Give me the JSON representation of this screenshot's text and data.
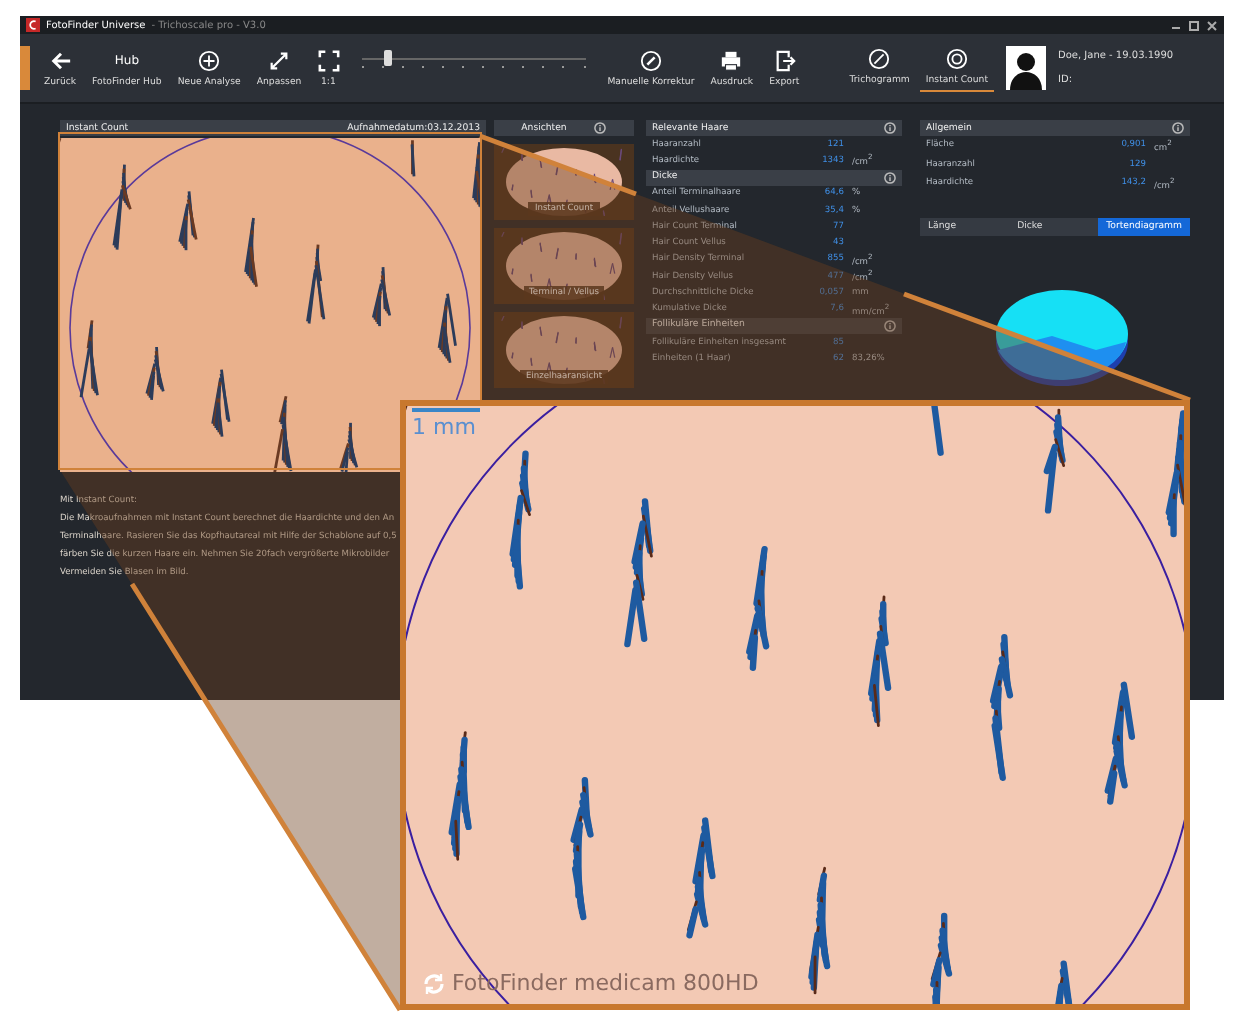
{
  "window": {
    "app_name": "FotoFinder Universe",
    "subtitle": "- Trichoscale pro - V3.0"
  },
  "toolbar": {
    "items": [
      {
        "kind": "back",
        "label": "Zurück"
      },
      {
        "kind": "hub",
        "label": "FotoFinder Hub",
        "glyph": "Hub"
      },
      {
        "kind": "add",
        "label": "Neue Analyse"
      },
      {
        "kind": "fit",
        "label": "Anpassen"
      },
      {
        "kind": "actual",
        "label": "1:1"
      }
    ],
    "zoom_slider": {
      "level": 0.1
    },
    "tools": [
      {
        "kind": "pencil",
        "label": "Manuelle Korrektur"
      },
      {
        "kind": "print",
        "label": "Ausdruck"
      },
      {
        "kind": "export",
        "label": "Export"
      }
    ]
  },
  "modes": [
    {
      "kind": "tricho",
      "label": "Trichogramm",
      "selected": false
    },
    {
      "kind": "count",
      "label": "Instant Count",
      "selected": true
    }
  ],
  "patient": {
    "name": "Doe, Jane - 19.03.1990",
    "id_label": "ID:"
  },
  "image_panel": {
    "title": "Instant Count",
    "date": "Aufnahmedatum:03.12.2013"
  },
  "views": {
    "title": "Ansichten",
    "items": [
      {
        "label": "Instant Count"
      },
      {
        "label": "Terminal / Vellus"
      },
      {
        "label": "Einzelhaaransicht"
      }
    ]
  },
  "stats": [
    {
      "title": "Relevante Haare",
      "rows": [
        {
          "label": "Haaranzahl",
          "value": "121",
          "unit": ""
        },
        {
          "label": "Haardichte",
          "value": "1343",
          "unit": "/cm$^{2}$"
        }
      ]
    },
    {
      "title": "Dicke",
      "rows": [
        {
          "label": "Anteil Terminalhaare",
          "value": "64,6",
          "unit": "%"
        },
        {
          "label": "Anteil Vellushaare",
          "value": "35,4",
          "unit": "%"
        },
        {
          "label": "Hair Count Terminal",
          "value": "77",
          "unit": ""
        },
        {
          "label": "Hair Count Vellus",
          "value": "43",
          "unit": ""
        },
        {
          "label": "Hair Density Terminal",
          "value": "855",
          "unit": "/cm$^{2}$"
        },
        {
          "label": "Hair Density Vellus",
          "value": "477",
          "unit": "/cm$^{2}$"
        },
        {
          "label": "Durchschnittliche Dicke",
          "value": "0,057",
          "unit": "mm"
        },
        {
          "label": "Kumulative Dicke",
          "value": "7,6",
          "unit": "mm/cm$^{2}$"
        }
      ]
    },
    {
      "title": "Follikuläre Einheiten",
      "rows": [
        {
          "label": "Follikuläre Einheiten insgesamt",
          "value": "85",
          "unit": ""
        },
        {
          "label": "Einheiten (1 Haar)",
          "value": "62",
          "unit": "83,26%"
        }
      ]
    }
  ],
  "general": {
    "title": "Allgemein",
    "rows": [
      {
        "label": "Fläche",
        "value": "0,901",
        "unit": "cm$^{2}$"
      },
      {
        "label": "Haaranzahl",
        "value": "129",
        "unit": ""
      },
      {
        "label": "Haardichte",
        "value": "143,2",
        "unit": "/cm$^{2}$"
      }
    ]
  },
  "chart_tabs": [
    {
      "label": "Länge",
      "selected": false
    },
    {
      "label": "Dicke",
      "selected": false
    },
    {
      "label": "Tortendiagramm",
      "selected": true
    }
  ],
  "description": [
    "Mit Instant Count:",
    "Die Makroaufnahmen mit Instant Count berechnet die Haardichte und den An",
    "Terminalhaare. Rasieren Sie das Kopfhautareal mit Hilfe der Schablone auf 0,5",
    "färben Sie die kurzen Haare ein. Nehmen Sie 20fach vergrößerte Mikrobilder",
    "Vermeiden Sie Blasen im Bild."
  ],
  "magnified": {
    "scale": "1 mm",
    "caption": "FotoFinder medicam 800HD"
  }
}
